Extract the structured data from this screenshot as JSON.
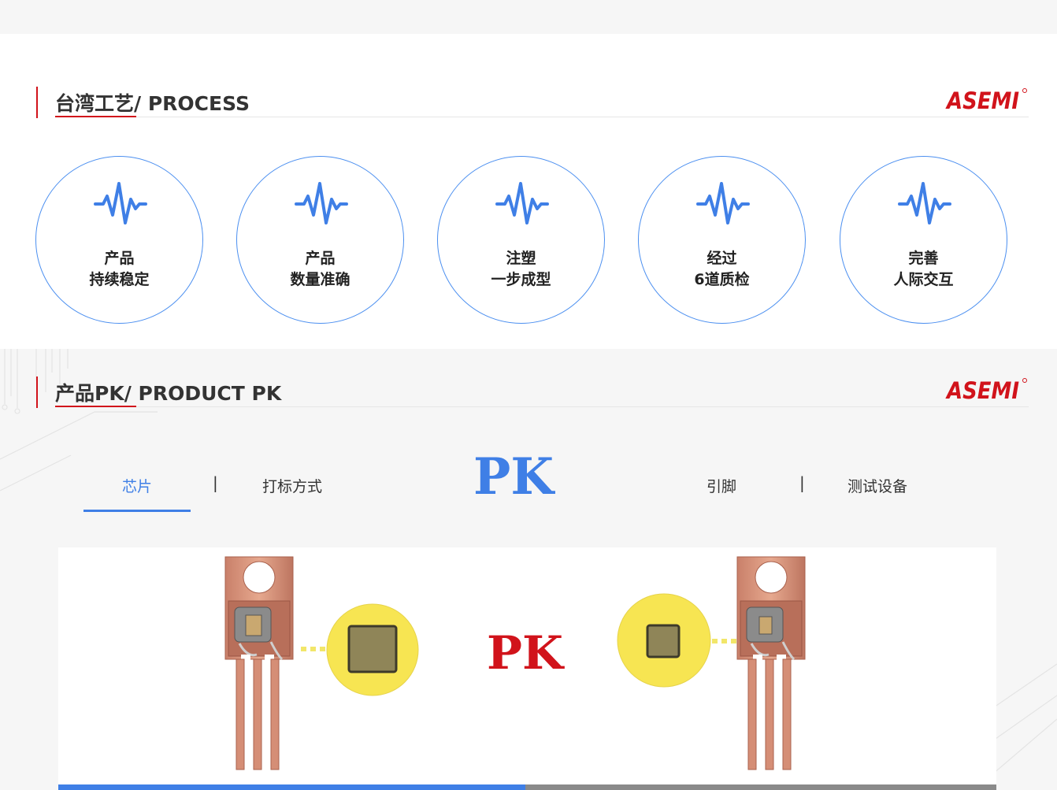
{
  "process": {
    "title": "台湾工艺/ PROCESS",
    "logo_text": "ASEMI",
    "items": [
      {
        "line1": "产品",
        "line2": "持续稳定"
      },
      {
        "line1": "产品",
        "line2": "数量准确"
      },
      {
        "line1": "注塑",
        "line2": "一步成型"
      },
      {
        "line1": "经过",
        "line2": "6道质检"
      },
      {
        "line1": "完善",
        "line2": "人际交互"
      }
    ]
  },
  "pk": {
    "title": "产品PK/ PRODUCT PK",
    "logo_text": "ASEMI",
    "tabs": {
      "chip": "芯片",
      "marking": "打标方式",
      "pins": "引脚",
      "testing": "测试设备"
    },
    "separator": "|",
    "center_text": "PK",
    "panel_text": "PK",
    "progress": 0.5
  },
  "colors": {
    "accent_blue": "#3f7fe6",
    "brand_red": "#d1131b",
    "chip_yellow": "#f7e552"
  },
  "icons": {
    "wave": "heartbeat-wave-icon"
  }
}
